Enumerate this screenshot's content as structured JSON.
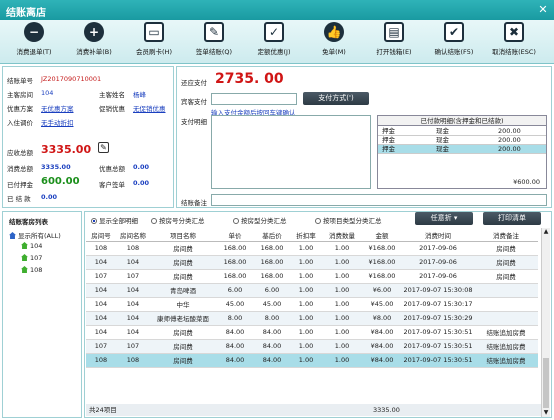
{
  "window": {
    "title": "结账离店",
    "close": "✕"
  },
  "toolbar": [
    {
      "label": "消费退单(T)",
      "icon": "minus-circle-icon",
      "glyph": "−",
      "shape": "circle"
    },
    {
      "label": "消费补单(B)",
      "icon": "plus-circle-icon",
      "glyph": "+",
      "shape": "circle"
    },
    {
      "label": "会员刷卡(H)",
      "icon": "card-icon",
      "glyph": "▭",
      "shape": "square"
    },
    {
      "label": "签单结账(Q)",
      "icon": "pen-sign-icon",
      "glyph": "✎",
      "shape": "square"
    },
    {
      "label": "定额优惠(J)",
      "icon": "discount-icon",
      "glyph": "✓",
      "shape": "square"
    },
    {
      "label": "免单(M)",
      "icon": "thumbs-up-icon",
      "glyph": "👍",
      "shape": "circle"
    },
    {
      "label": "打开钱箱(E)",
      "icon": "cash-box-icon",
      "glyph": "▤",
      "shape": "square"
    },
    {
      "label": "确认结账(F5)",
      "icon": "confirm-checkout-icon",
      "glyph": "✔",
      "shape": "square"
    },
    {
      "label": "取消结账(ESC)",
      "icon": "cancel-checkout-icon",
      "glyph": "✖",
      "shape": "square"
    }
  ],
  "info": {
    "bill_no_label": "结账单号",
    "bill_no": "JZ2017090710001",
    "room_label": "主客房间",
    "room": "104",
    "guest_label": "主客姓名",
    "guest": "杨峰",
    "promo_label": "优惠方案",
    "promo": "无优惠方案",
    "promo2_label": "促销优惠",
    "promo2": "无促销优惠",
    "adjust_label": "入住调价",
    "adjust": "无手动折扣",
    "due_label": "应收总额",
    "due": "3335.00",
    "consume_label": "消费总额",
    "consume": "3335.00",
    "discount_label": "优惠总额",
    "discount": "0.00",
    "deposit_label": "已付押金",
    "deposit": "600.00",
    "sign_label": "客户签单",
    "sign": "0.00",
    "settled_label": "已 结 款",
    "settled": "0.00"
  },
  "payment": {
    "back_label": "还应支付",
    "back_amount": "2735. 00",
    "pay_label": "宾客支付",
    "pay_value": "",
    "method_button": "支付方式(')",
    "hint": "输入支付金额后按回车键确认",
    "detail_label": "支付明细",
    "paid_detail_title": "已付款明细(含押金和已结款)",
    "paid_rows": [
      {
        "type": "押金",
        "method": "现金",
        "amount": "200.00"
      },
      {
        "type": "押金",
        "method": "现金",
        "amount": "200.00"
      },
      {
        "type": "押金",
        "method": "现金",
        "amount": "200.00"
      }
    ],
    "paid_total": "¥600.00",
    "remark_label": "结账备注"
  },
  "tree": {
    "title": "结账客房列表",
    "root": "显示所有(ALL)",
    "rooms": [
      "104",
      "107",
      "108"
    ]
  },
  "filters": {
    "options": [
      "显示全部明细",
      "按房号分类汇总",
      "按房型分类汇总",
      "按项目类型分类汇总"
    ],
    "selected": 0,
    "more": "任意折",
    "print": "打印清单"
  },
  "grid": {
    "columns": [
      "房间号",
      "房间名称",
      "项目名称",
      "单价",
      "基后价",
      "折扣率",
      "消费数量",
      "金额",
      "消费时间",
      "消费备注"
    ],
    "rows": [
      [
        "108",
        "108",
        "房间费",
        "168.00",
        "168.00",
        "1.00",
        "1.00",
        "¥168.00",
        "2017-09-06",
        "房间费"
      ],
      [
        "104",
        "104",
        "房间费",
        "168.00",
        "168.00",
        "1.00",
        "1.00",
        "¥168.00",
        "2017-09-06",
        "房间费"
      ],
      [
        "107",
        "107",
        "房间费",
        "168.00",
        "168.00",
        "1.00",
        "1.00",
        "¥168.00",
        "2017-09-06",
        "房间费"
      ],
      [
        "104",
        "104",
        "青岛啤酒",
        "6.00",
        "6.00",
        "1.00",
        "1.00",
        "¥6.00",
        "2017-09-07 15:30:08",
        ""
      ],
      [
        "104",
        "104",
        "中华",
        "45.00",
        "45.00",
        "1.00",
        "1.00",
        "¥45.00",
        "2017-09-07 15:30:17",
        ""
      ],
      [
        "104",
        "104",
        "康师傅老坛酸菜面",
        "8.00",
        "8.00",
        "1.00",
        "1.00",
        "¥8.00",
        "2017-09-07 15:30:29",
        ""
      ],
      [
        "104",
        "104",
        "房间费",
        "84.00",
        "84.00",
        "1.00",
        "1.00",
        "¥84.00",
        "2017-09-07 15:30:51",
        "结账追加房费"
      ],
      [
        "107",
        "107",
        "房间费",
        "84.00",
        "84.00",
        "1.00",
        "1.00",
        "¥84.00",
        "2017-09-07 15:30:51",
        "结账追加房费"
      ],
      [
        "108",
        "108",
        "房间费",
        "84.00",
        "84.00",
        "1.00",
        "1.00",
        "¥84.00",
        "2017-09-07 15:30:51",
        "结账追加房费"
      ]
    ],
    "selected_row": 8,
    "footer_count": "共24项目",
    "footer_total": "3335.00"
  }
}
